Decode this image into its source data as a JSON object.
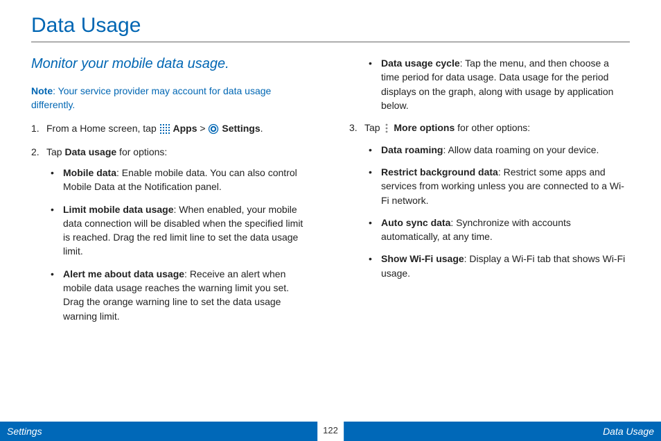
{
  "title": "Data Usage",
  "subtitle": "Monitor your mobile data usage.",
  "note": {
    "label": "Note",
    "text": ": Your service provider may account for data usage differently."
  },
  "steps": {
    "s1": {
      "num": "1.",
      "pre": "From a Home screen, tap ",
      "apps": "Apps",
      "gt": " > ",
      "settings": "Settings",
      "post": "."
    },
    "s2": {
      "num": "2.",
      "pre": "Tap ",
      "bold": "Data usage",
      "post": " for options:"
    },
    "s3": {
      "num": "3.",
      "pre": "Tap ",
      "bold": "More options",
      "post": " for other options:"
    }
  },
  "bullets_left": [
    {
      "bold": "Mobile data",
      "text": ": Enable mobile data. You can also control Mobile Data at the Notification panel."
    },
    {
      "bold": "Limit mobile data usage",
      "text": ": When enabled, your mobile data connection will be disabled when the specified limit is reached. Drag the red limit line to set the data usage limit."
    },
    {
      "bold": "Alert me about data usage",
      "text": ": Receive an alert when mobile data usage reaches the warning limit you set. Drag the orange warning line to set the data usage warning limit."
    }
  ],
  "bullets_right_top": [
    {
      "bold": "Data usage cycle",
      "text": ": Tap the menu, and then choose a time period for data usage. Data usage for the period displays on the graph, along with usage by application below."
    }
  ],
  "bullets_right_more": [
    {
      "bold": "Data roaming",
      "text": ": Allow data roaming on your device."
    },
    {
      "bold": "Restrict background data",
      "text": ": Restrict some apps and services from working unless you are connected to a Wi-Fi network."
    },
    {
      "bold": "Auto sync data",
      "text": ": Synchronize with accounts automatically, at any time."
    },
    {
      "bold": "Show Wi-Fi usage",
      "text": ": Display a Wi-Fi tab that shows Wi-Fi usage."
    }
  ],
  "footer": {
    "left": "Settings",
    "page": "122",
    "right": "Data Usage"
  }
}
